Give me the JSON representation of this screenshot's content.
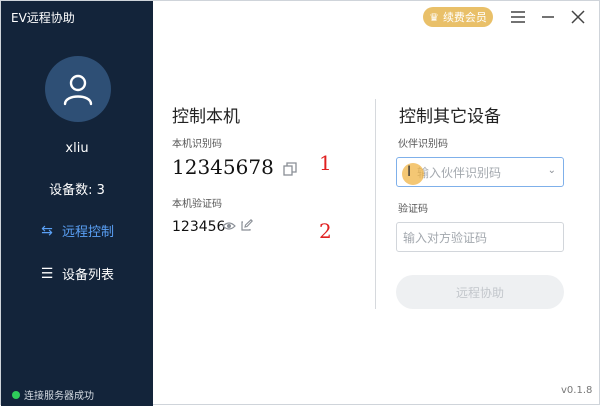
{
  "app": {
    "title": "EV远程协助",
    "version": "v0.1.8"
  },
  "sidebar": {
    "username": "xliu",
    "device_count": "设备数: 3",
    "nav": [
      {
        "label": "远程控制",
        "icon": "swap-arrows-icon",
        "active": true
      },
      {
        "label": "设备列表",
        "icon": "list-icon",
        "active": false
      }
    ],
    "status": "连接服务器成功"
  },
  "titlebar": {
    "vip_label": "续费会员"
  },
  "local": {
    "title": "控制本机",
    "id_label": "本机识别码",
    "id_value": "12345678",
    "code_label": "本机验证码",
    "code_value": "123456",
    "annotation_1": "1",
    "annotation_2": "2"
  },
  "remote": {
    "title": "控制其它设备",
    "partner_label": "伙伴识别码",
    "partner_placeholder": "输入伙伴识别码",
    "verify_label": "验证码",
    "verify_placeholder": "输入对方验证码",
    "connect_label": "远程协助"
  },
  "colors": {
    "sidebar_bg": "#13243a",
    "accent": "#5aa0f5",
    "vip_gold": "#e9c069",
    "status_green": "#2ecc5a",
    "annotation_red": "#e02020"
  }
}
